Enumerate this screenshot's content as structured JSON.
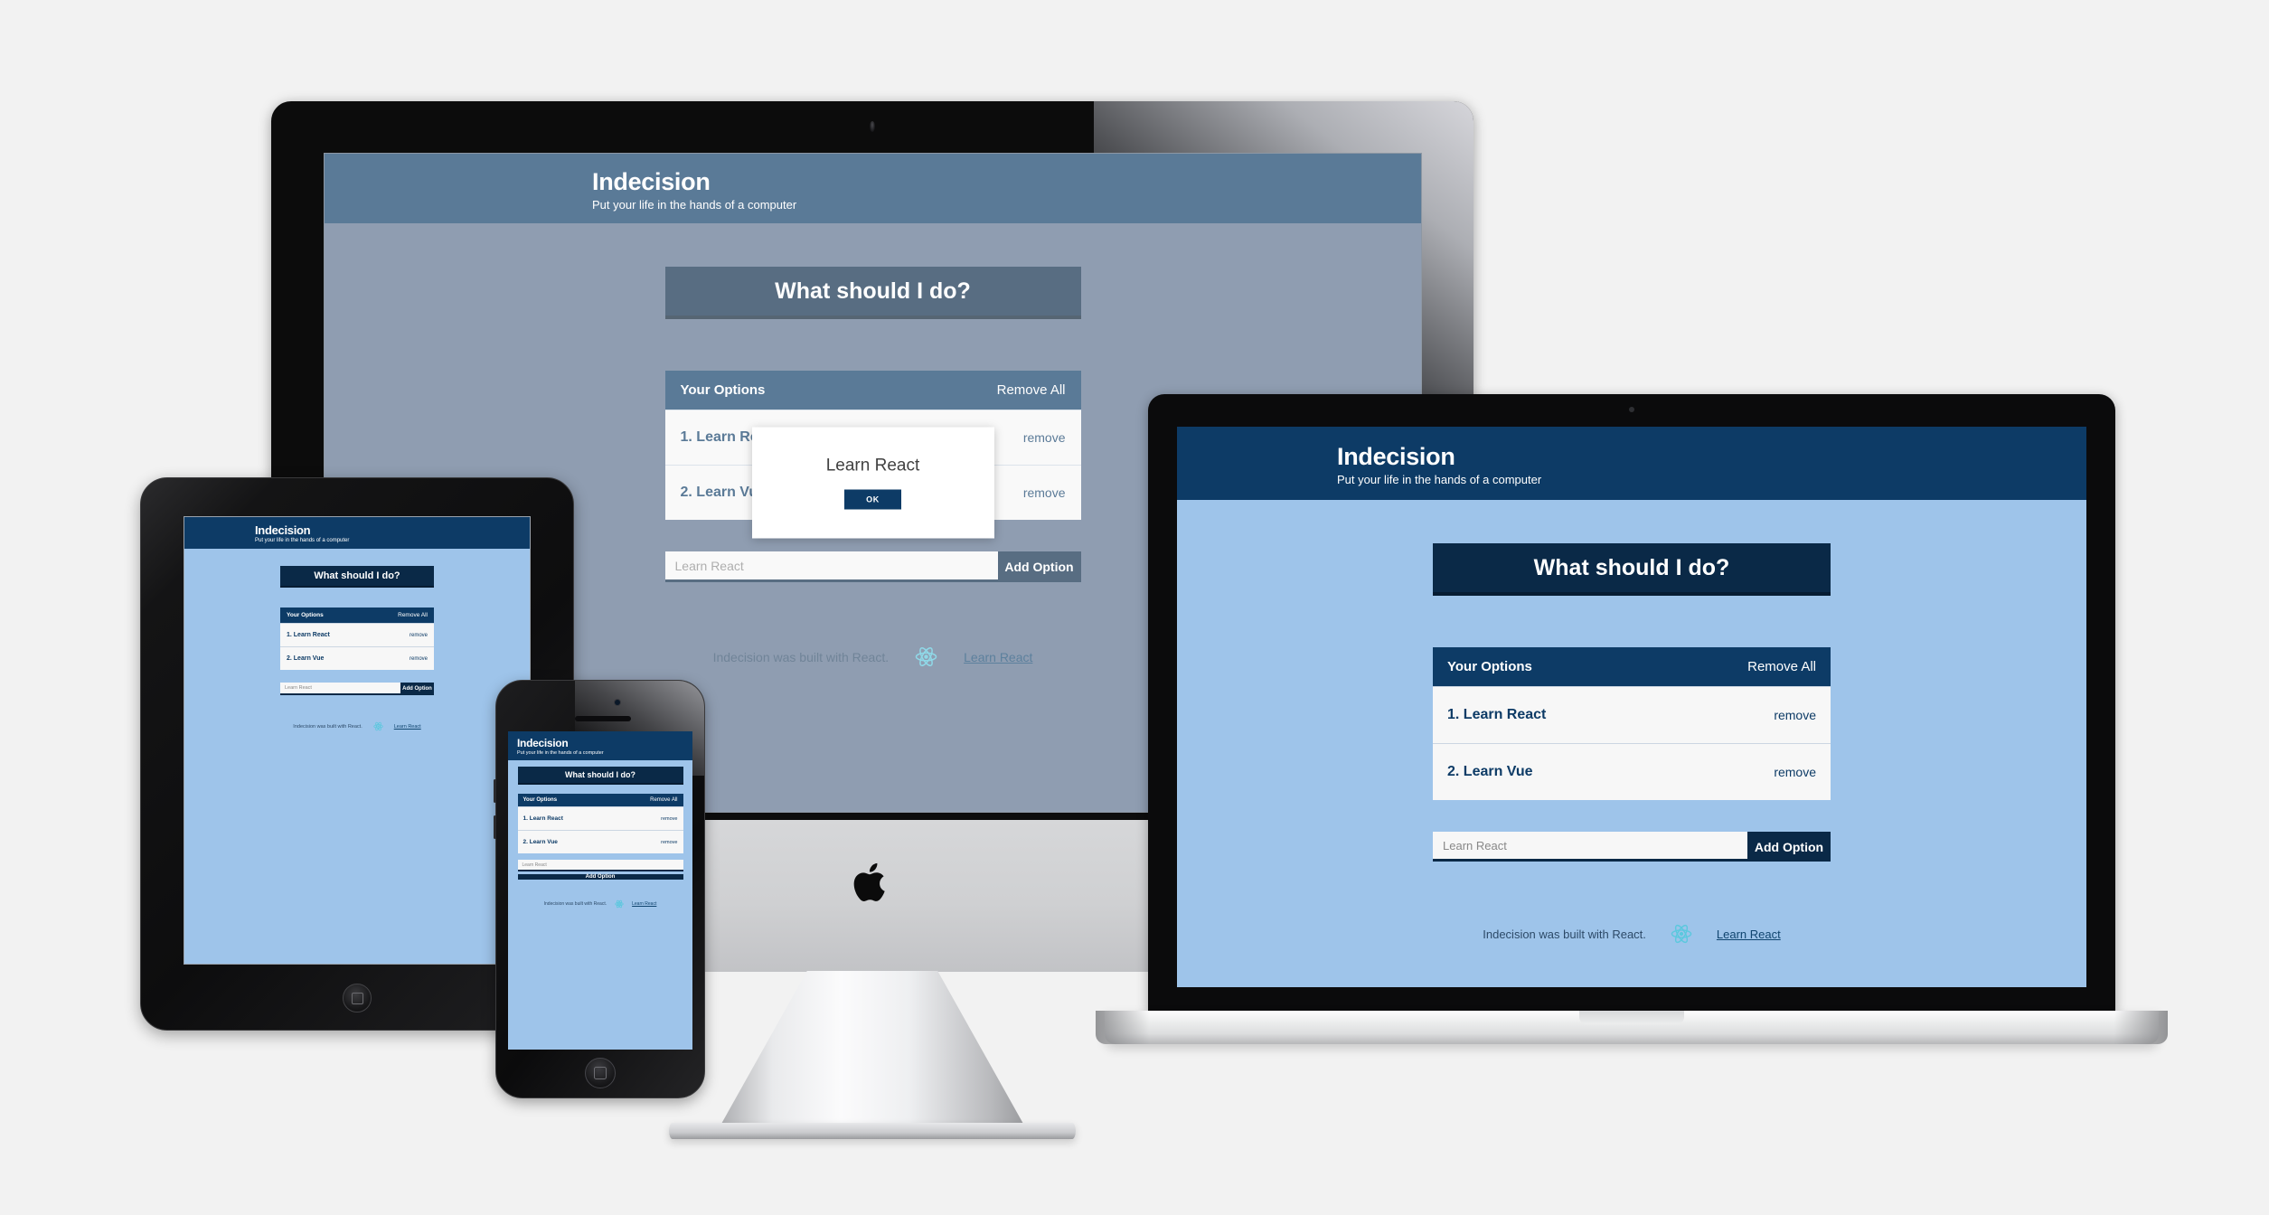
{
  "app": {
    "title": "Indecision",
    "subtitle": "Put your life in the hands of a computer",
    "action_button": "What should I do?",
    "options_header": "Your Options",
    "remove_all": "Remove All",
    "options": [
      {
        "label": "1. Learn React",
        "remove": "remove"
      },
      {
        "label": "2. Learn Vue",
        "remove": "remove"
      }
    ],
    "input_placeholder": "Learn React",
    "add_button": "Add Option",
    "footer_text": "Indecision was built with React.",
    "footer_link": "Learn React",
    "react_icon": "react-atom-icon"
  },
  "modal": {
    "title": "Learn React",
    "ok": "OK"
  },
  "colors": {
    "header_navy": "#0d3b66",
    "deep_navy": "#0a2947",
    "body_blue": "#9ec4ea",
    "body_blue_dim": "#5a6f8c",
    "option_bg": "#f7f7f7",
    "react_cyan": "#61dafb",
    "page_bg": "#f2f2f2"
  }
}
